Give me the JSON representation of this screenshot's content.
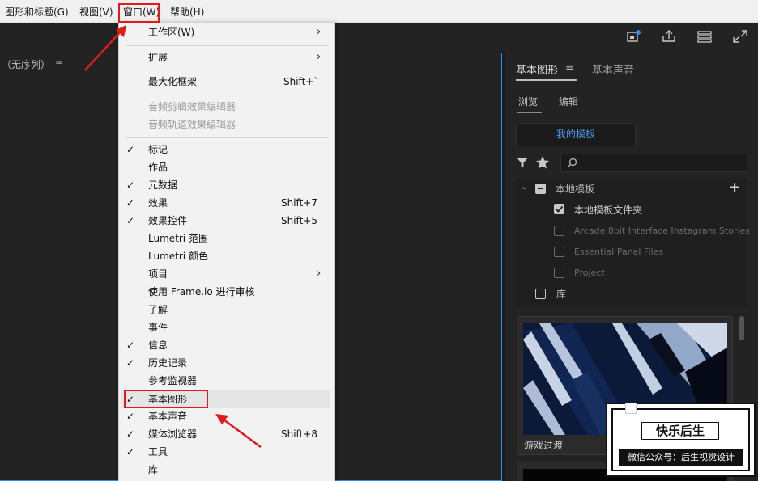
{
  "menubar": {
    "items": [
      "图形和标题(G)",
      "视图(V)",
      "窗口(W)",
      "帮助(H)"
    ]
  },
  "left_panel": {
    "title": "（无序列）",
    "menu_glyph": "≡"
  },
  "right_panel": {
    "tabs": [
      "基本图形",
      "基本声音"
    ],
    "tab_menu_glyph": "≡",
    "subtabs": [
      "浏览",
      "编辑"
    ],
    "my_templates_button": "我的模板",
    "tree": {
      "root": "本地模板",
      "items": [
        {
          "label": "本地模板文件夹",
          "checked": true
        },
        {
          "label": "Arcade 8bit Interface Instagram Stories",
          "checked": false
        },
        {
          "label": "Essential Panel Files",
          "checked": false
        },
        {
          "label": "Project",
          "checked": false
        }
      ],
      "library": "库"
    },
    "thumbnail_caption": "游戏过渡"
  },
  "dropdown": {
    "items": [
      {
        "label": "工作区(W)",
        "submenu": true,
        "enabled": true
      },
      {
        "label": "扩展",
        "submenu": true,
        "enabled": true
      },
      {
        "label": "最大化框架",
        "shortcut": "Shift+`",
        "enabled": true
      },
      {
        "label": "音频剪辑效果编辑器",
        "enabled": false
      },
      {
        "label": "音频轨道效果编辑器",
        "enabled": false
      },
      {
        "label": "标记",
        "checked": true,
        "enabled": true
      },
      {
        "label": "作品",
        "enabled": true
      },
      {
        "label": "元数据",
        "checked": true,
        "enabled": true
      },
      {
        "label": "效果",
        "checked": true,
        "shortcut": "Shift+7",
        "enabled": true
      },
      {
        "label": "效果控件",
        "checked": true,
        "shortcut": "Shift+5",
        "enabled": true
      },
      {
        "label": "Lumetri 范围",
        "enabled": true
      },
      {
        "label": "Lumetri 颜色",
        "enabled": true
      },
      {
        "label": "项目",
        "submenu": true,
        "enabled": true
      },
      {
        "label": "使用 Frame.io 进行审核",
        "enabled": true
      },
      {
        "label": "了解",
        "enabled": true
      },
      {
        "label": "事件",
        "enabled": true
      },
      {
        "label": "信息",
        "checked": true,
        "enabled": true
      },
      {
        "label": "历史记录",
        "checked": true,
        "enabled": true
      },
      {
        "label": "参考监视器",
        "enabled": true
      },
      {
        "label": "基本图形",
        "checked": true,
        "enabled": true,
        "highlighted": true
      },
      {
        "label": "基本声音",
        "checked": true,
        "enabled": true
      },
      {
        "label": "媒体浏览器",
        "checked": true,
        "shortcut": "Shift+8",
        "enabled": true
      },
      {
        "label": "工具",
        "checked": true,
        "enabled": true
      },
      {
        "label": "库",
        "enabled": true
      }
    ],
    "check_glyph": "✓",
    "submenu_glyph": "›"
  },
  "watermark": {
    "title": "快乐后生",
    "subtitle": "微信公众号：后生视觉设计"
  },
  "colors": {
    "annotation_red": "#e01b1b",
    "accent_blue": "#2d8ceb",
    "link_blue": "#4b9cf1"
  }
}
